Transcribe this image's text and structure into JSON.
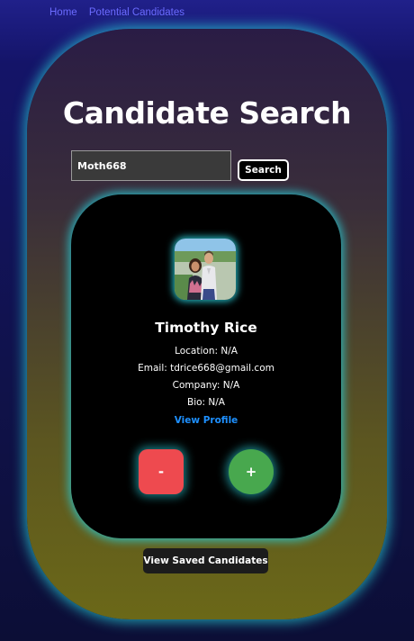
{
  "nav": {
    "items": [
      {
        "label": "Home"
      },
      {
        "label": "Potential Candidates"
      }
    ]
  },
  "page": {
    "title": "Candidate Search"
  },
  "search": {
    "value": "Moth668",
    "button_label": "Search"
  },
  "candidate": {
    "name": "Timothy Rice",
    "location": "Location: N/A",
    "email": "Email: tdrice668@gmail.com",
    "company": "Company: N/A",
    "bio": "Bio: N/A",
    "profile_link": "View Profile"
  },
  "actions": {
    "reject_label": "-",
    "accept_label": "+",
    "saved_label": "View Saved Candidates"
  },
  "colors": {
    "accent_glow": "#28c8d2",
    "link": "#1e90ff",
    "nav_link": "#6b6bff",
    "reject": "#ee4a4f",
    "accept": "#48a84e"
  }
}
